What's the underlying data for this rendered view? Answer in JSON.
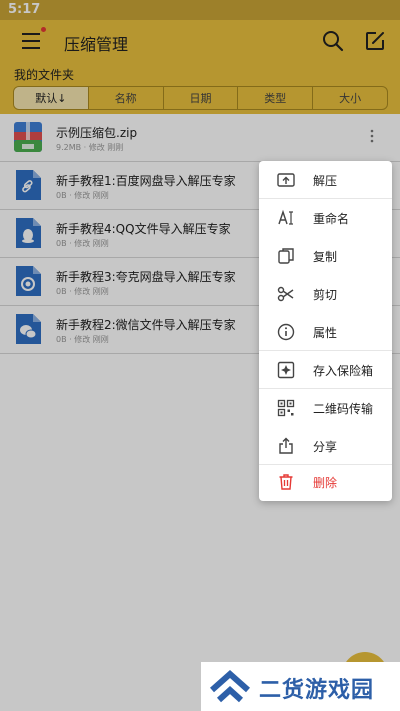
{
  "status_bar": {
    "time": "5:17"
  },
  "app_bar": {
    "title": "压缩管理"
  },
  "folder": {
    "title": "我的文件夹"
  },
  "sort_tabs": [
    {
      "label": "默认↓",
      "active": true
    },
    {
      "label": "名称",
      "active": false
    },
    {
      "label": "日期",
      "active": false
    },
    {
      "label": "类型",
      "active": false
    },
    {
      "label": "大小",
      "active": false
    }
  ],
  "files": [
    {
      "name": "示例压缩包.zip",
      "meta": "9.2MB · 修改 刚刚",
      "icon": "zip-archive-icon"
    },
    {
      "name": "新手教程1:百度网盘导入解压专家",
      "meta": "0B · 修改 刚刚",
      "icon": "link-file-icon"
    },
    {
      "name": "新手教程4:QQ文件导入解压专家",
      "meta": "0B · 修改 刚刚",
      "icon": "qq-file-icon"
    },
    {
      "name": "新手教程3:夸克网盘导入解压专家",
      "meta": "0B · 修改 刚刚",
      "icon": "quark-file-icon"
    },
    {
      "name": "新手教程2:微信文件导入解压专家",
      "meta": "0B · 修改 刚刚",
      "icon": "wechat-file-icon"
    }
  ],
  "context_menu": {
    "items": [
      {
        "label": "解压",
        "icon": "extract-icon"
      },
      {
        "label": "重命名",
        "icon": "rename-icon"
      },
      {
        "label": "复制",
        "icon": "copy-icon"
      },
      {
        "label": "剪切",
        "icon": "scissors-icon"
      },
      {
        "label": "属性",
        "icon": "info-icon"
      },
      {
        "label": "存入保险箱",
        "icon": "safe-icon"
      },
      {
        "label": "二维码传输",
        "icon": "qr-code-icon"
      },
      {
        "label": "分享",
        "icon": "share-icon"
      },
      {
        "label": "删除",
        "icon": "trash-icon"
      }
    ]
  },
  "watermark": {
    "text": "二货游戏园"
  },
  "colors": {
    "accent": "#e9c03e",
    "danger": "#e53935",
    "file_blue": "#2f6fc3"
  }
}
